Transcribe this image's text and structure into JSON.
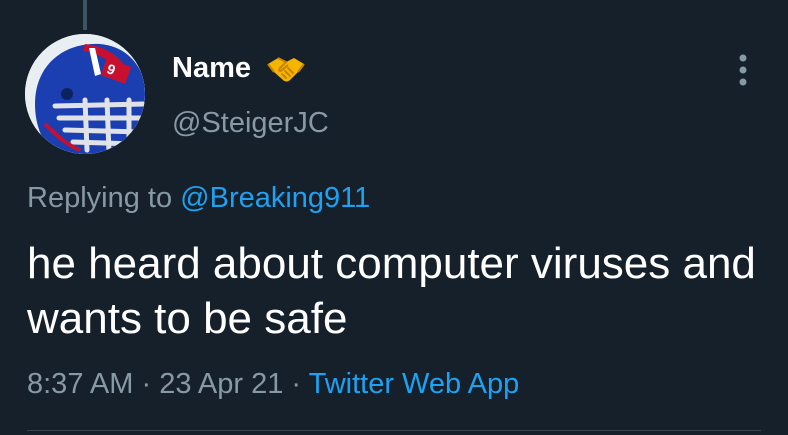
{
  "tweet": {
    "display_name": "Name",
    "handle": "@SteigerJC",
    "reply_prefix": "Replying to ",
    "reply_mention": "@Breaking911",
    "text": "he heard about computer viruses and wants to be safe",
    "time": "8:37 AM",
    "separator": " · ",
    "date": "23 Apr 21",
    "source": "Twitter Web App"
  },
  "icons": {
    "avatar": "football-helmet-avatar",
    "badge": "handshake-emoji-icon",
    "more": "vertical-ellipsis-icon"
  },
  "colors": {
    "background": "#15202b",
    "primary_text": "#ffffff",
    "secondary_text": "#8899a6",
    "accent": "#1da1f2"
  }
}
